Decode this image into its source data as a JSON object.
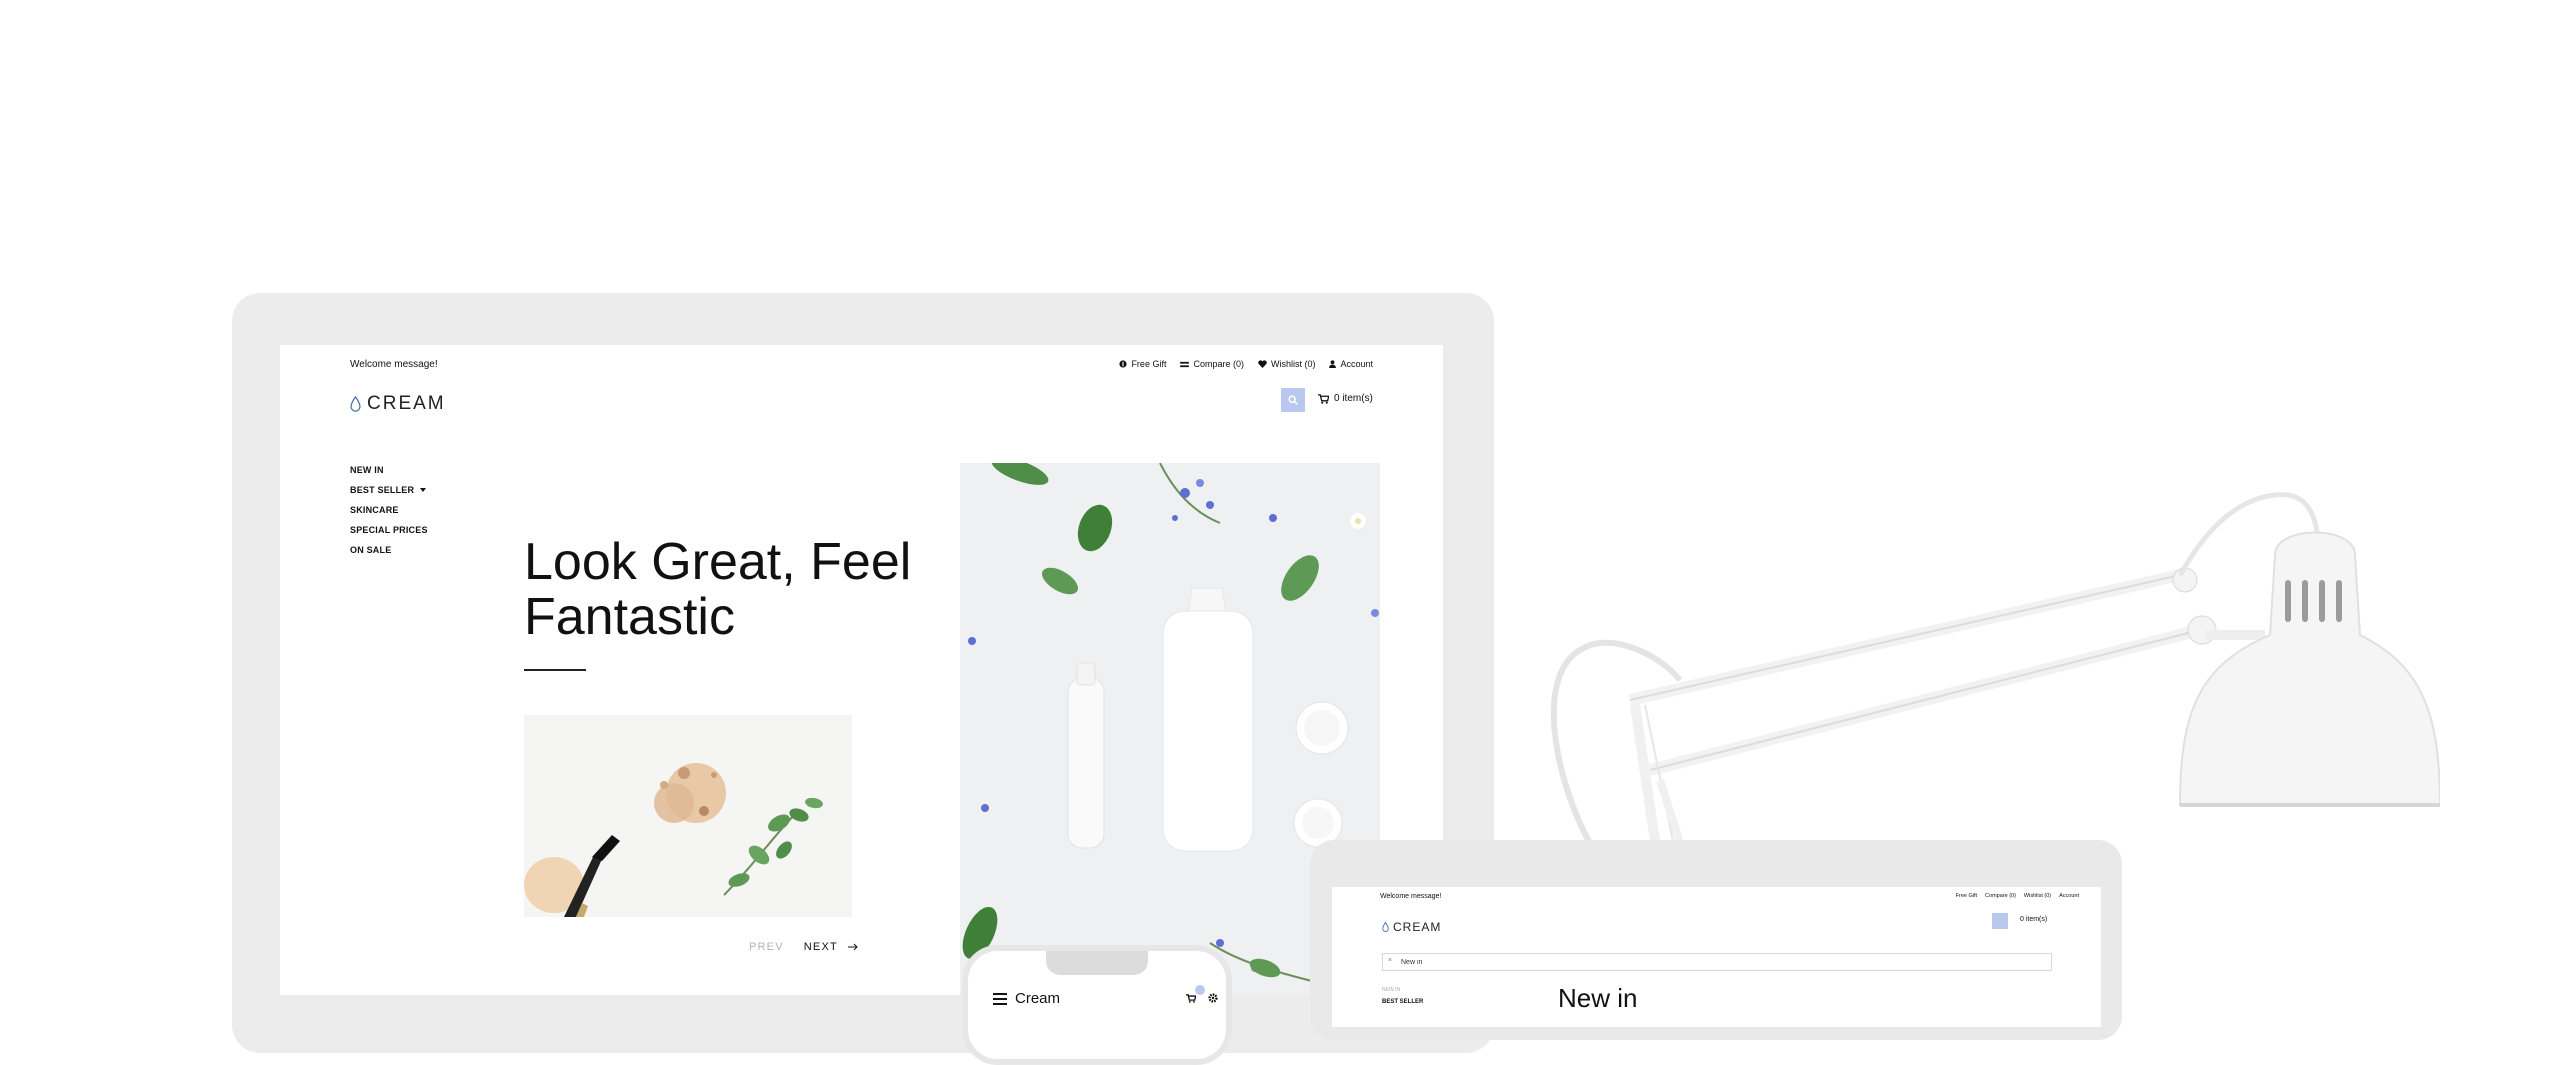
{
  "desktop": {
    "welcome": "Welcome message!",
    "top_links": {
      "free_gift": "Free Gift",
      "compare": "Compare (0)",
      "wishlist": "Wishlist (0)",
      "account": "Account"
    },
    "logo": "CREAM",
    "cart": "0 item(s)",
    "nav": {
      "new_in": "NEW IN",
      "best_seller": "BEST SELLER",
      "skincare": "SKINCARE",
      "special_prices": "SPECIAL PRICES",
      "on_sale": "ON SALE"
    },
    "hero_title": "Look Great, Feel Fantastic",
    "prev": "PREV",
    "next": "NEXT"
  },
  "laptop": {
    "welcome": "Welcome message!",
    "top_links": {
      "free_gift": "Free Gift",
      "compare": "Compare (0)",
      "wishlist": "Wishlist (0)",
      "account": "Account"
    },
    "logo": "CREAM",
    "cart": "0 item(s)",
    "search_value": "New in",
    "nav_small": "NEW IN",
    "nav_best_seller": "BEST SELLER",
    "heading": "New in"
  },
  "phone": {
    "title": "Cream"
  },
  "colors": {
    "accent": "#b8c8ee",
    "text": "#111111",
    "muted": "#b3b3b3",
    "device_frame": "#ececec"
  },
  "icons": [
    "gift-icon",
    "compare-icon",
    "heart-icon",
    "user-icon",
    "drop-logo-icon",
    "search-icon",
    "cart-icon",
    "caret-down-icon",
    "arrow-right-icon",
    "hamburger-icon",
    "gear-icon"
  ]
}
